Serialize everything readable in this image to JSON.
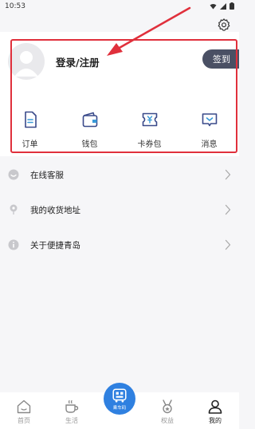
{
  "status_bar": {
    "time": "10:53",
    "icons": [
      "wifi-icon",
      "signal-icon",
      "battery-icon"
    ]
  },
  "profile": {
    "login_label": "登录/注册",
    "signin_label": "签到"
  },
  "quick_actions": [
    {
      "label": "订单",
      "icon": "order-icon"
    },
    {
      "label": "钱包",
      "icon": "wallet-icon"
    },
    {
      "label": "卡券包",
      "icon": "coupon-icon"
    },
    {
      "label": "消息",
      "icon": "message-icon"
    }
  ],
  "menu": [
    {
      "label": "在线客服",
      "icon": "customer-service-icon"
    },
    {
      "label": "我的收货地址",
      "icon": "location-icon"
    },
    {
      "label": "关于便捷青岛",
      "icon": "info-icon"
    }
  ],
  "tabs": [
    {
      "label": "首页",
      "icon": "home-icon"
    },
    {
      "label": "生活",
      "icon": "cup-icon"
    },
    {
      "label": "乘车码",
      "icon": "bus-code-icon"
    },
    {
      "label": "权益",
      "icon": "medal-icon"
    },
    {
      "label": "我的",
      "icon": "person-icon"
    }
  ],
  "colors": {
    "accent": "#2f80e0",
    "signin_bg": "#4a5064",
    "annotation": "#e0303c",
    "icon_blue": "#3a4a8a"
  }
}
